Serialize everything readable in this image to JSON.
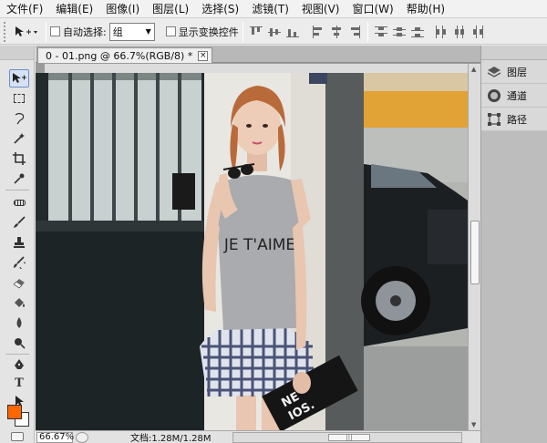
{
  "menu": {
    "items": [
      "文件(F)",
      "编辑(E)",
      "图像(I)",
      "图层(L)",
      "选择(S)",
      "滤镜(T)",
      "视图(V)",
      "窗口(W)",
      "帮助(H)"
    ]
  },
  "options": {
    "tool_preset_icon": "move-tool-icon",
    "auto_select_label": "自动选择:",
    "auto_select_value": "组",
    "show_transform_label": "显示变换控件"
  },
  "toolbox": {
    "tools": [
      "move-tool",
      "marquee-tool",
      "lasso-tool",
      "magic-wand-tool",
      "crop-tool",
      "eyedropper-tool",
      "healing-brush-tool",
      "brush-tool",
      "clone-stamp-tool",
      "history-brush-tool",
      "eraser-tool",
      "paint-bucket-tool",
      "blur-tool",
      "dodge-tool",
      "pen-tool",
      "type-tool",
      "path-selection-tool"
    ],
    "foreground_color": "#ff6600",
    "background_color": "#ffffff"
  },
  "document": {
    "tab_title": "0 - 01.png @ 66.7%(RGB/8) *",
    "zoom": "66.67%",
    "doc_info": "文档:1.28M/1.28M",
    "shirt_text": "JE T'AIME",
    "bag_text": [
      "NE",
      "IOS."
    ]
  },
  "panels": {
    "items": [
      {
        "label": "图层",
        "icon": "layers-icon"
      },
      {
        "label": "通道",
        "icon": "channels-icon"
      },
      {
        "label": "路径",
        "icon": "paths-icon"
      }
    ]
  }
}
